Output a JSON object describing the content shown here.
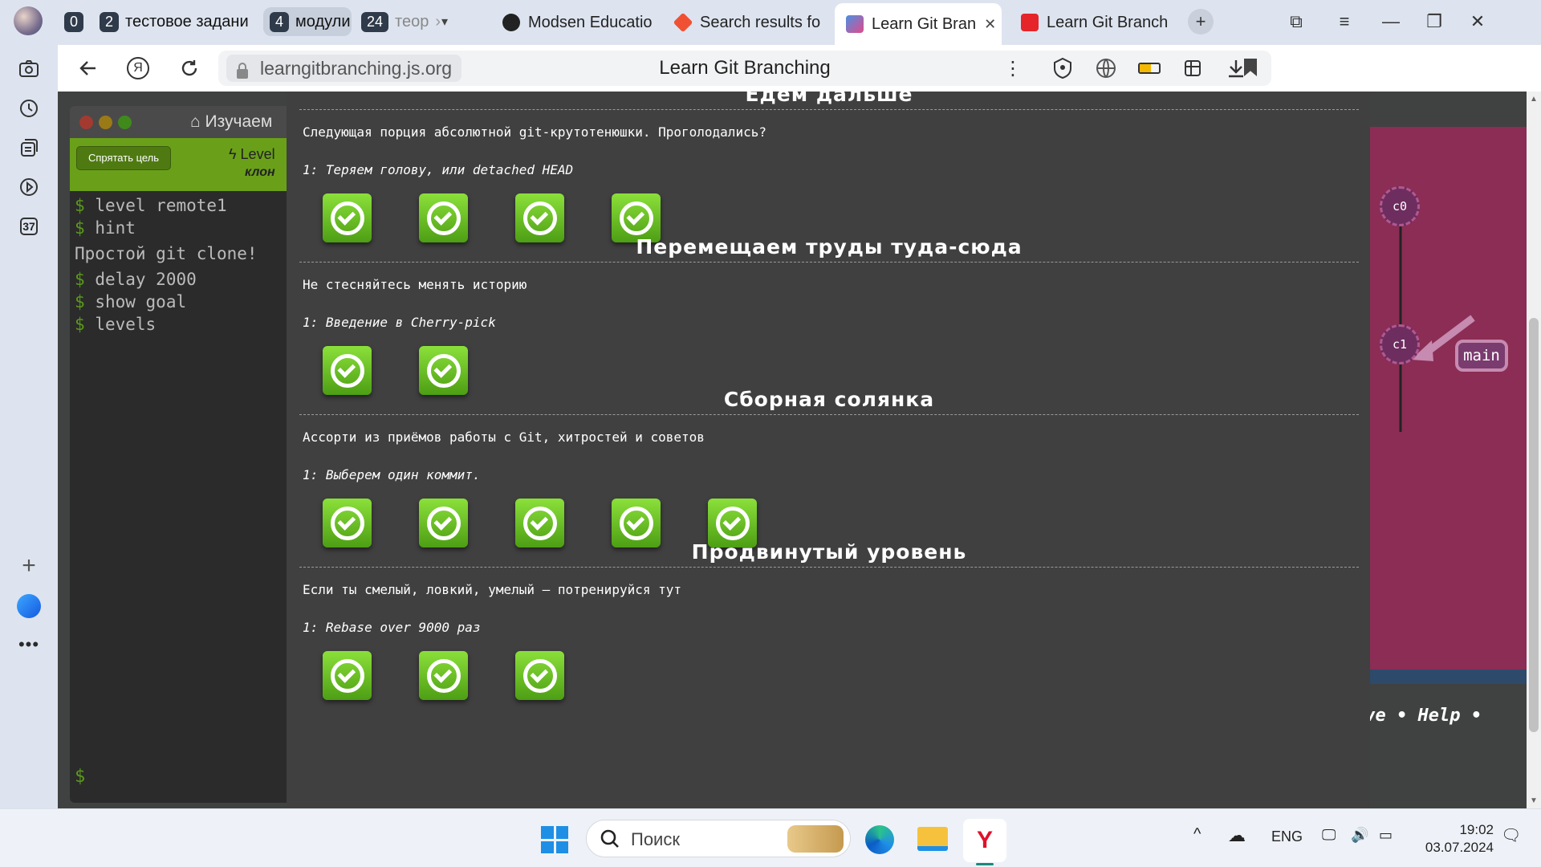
{
  "browser": {
    "workspaces": [
      {
        "num": "0",
        "label": ""
      },
      {
        "num": "2",
        "label": "тестовое задани"
      },
      {
        "num": "4",
        "label": "модули"
      },
      {
        "num": "24",
        "label": "теор"
      }
    ],
    "tabs": [
      {
        "label": "Modsen Educatio",
        "icon": "github-icon",
        "color": "#222"
      },
      {
        "label": "Search results fo",
        "icon": "git-icon",
        "color": "#f05133"
      },
      {
        "label": "Learn Git Bran",
        "icon": "learngit-icon",
        "color": "#3b7fd6",
        "active": true
      },
      {
        "label": "Learn Git Branch",
        "icon": "pdf-icon",
        "color": "#e5252a"
      }
    ],
    "url": "learngitbranching.js.org",
    "page_title": "Learn Git Branching",
    "sidebar_badge": "37"
  },
  "terminal": {
    "title": "Изучаем",
    "hide_goal": "Спрятать цель",
    "level_line": "Level",
    "level_sub": "клон",
    "lines": [
      {
        "prompt": "$",
        "text": "level remote1"
      },
      {
        "prompt": "$",
        "text": "hint"
      },
      {
        "prompt": "",
        "text": "Простой git clone!"
      },
      {
        "prompt": "$",
        "text": "delay 2000"
      },
      {
        "prompt": "$",
        "text": "show goal"
      },
      {
        "prompt": "$",
        "text": "levels"
      }
    ],
    "prompt": "$"
  },
  "viz": {
    "nodes": [
      "c0",
      "c1"
    ],
    "branch": "main",
    "help_text": "ive • Help •"
  },
  "modal": {
    "sections": [
      {
        "title": "Едем дальше",
        "desc": "Следующая порция абсолютной git-крутотенюшки. Проголодались?",
        "sub": "1: Теряем голову, или detached HEAD",
        "levels": 4
      },
      {
        "title": "Перемещаем труды туда-сюда",
        "desc": "Не стесняйтесь менять историю",
        "sub": "1: Введение в Cherry-pick",
        "levels": 2
      },
      {
        "title": "Сборная солянка",
        "desc": "Ассорти из приёмов работы с Git, хитростей и советов",
        "sub": "1: Выберем один коммит.",
        "levels": 5
      },
      {
        "title": "Продвинутый уровень",
        "desc": "Если ты смелый, ловкий, умелый – потренируйся тут",
        "sub": "1: Rebase over 9000 раз",
        "levels": 3
      }
    ]
  },
  "taskbar": {
    "search_placeholder": "Поиск",
    "lang": "ENG",
    "time": "19:02",
    "date": "03.07.2024"
  }
}
